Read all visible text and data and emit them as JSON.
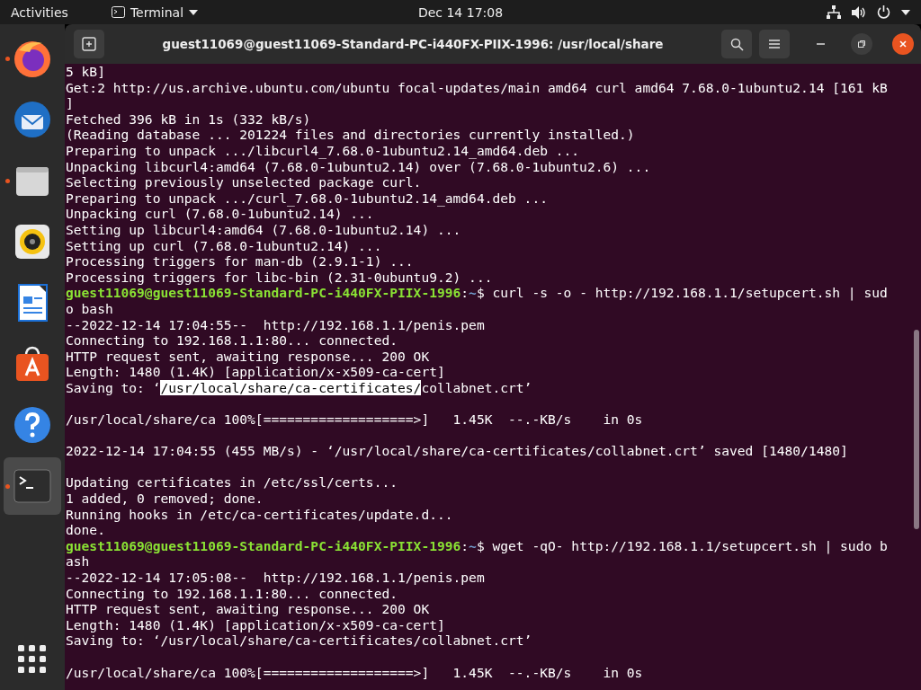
{
  "top_bar": {
    "activities": "Activities",
    "app_menu": "Terminal",
    "clock": "Dec 14  17:08"
  },
  "dock": {
    "items": [
      {
        "kind": "firefox",
        "running": true,
        "selected": false
      },
      {
        "kind": "thunderbird",
        "running": false,
        "selected": false
      },
      {
        "kind": "files",
        "running": true,
        "selected": false
      },
      {
        "kind": "rhythmbox",
        "running": false,
        "selected": false
      },
      {
        "kind": "writer",
        "running": false,
        "selected": false
      },
      {
        "kind": "software",
        "running": false,
        "selected": false
      },
      {
        "kind": "help",
        "running": false,
        "selected": false
      },
      {
        "kind": "terminal",
        "running": true,
        "selected": true
      }
    ]
  },
  "window": {
    "title": "guest11069@guest11069-Standard-PC-i440FX-PIIX-1996: /usr/local/share"
  },
  "terminal": {
    "lines": [
      {
        "segments": [
          {
            "kind": "plain",
            "text": "5 kB]"
          }
        ]
      },
      {
        "segments": [
          {
            "kind": "plain",
            "text": "Get:2 http://us.archive.ubuntu.com/ubuntu focal-updates/main amd64 curl amd64 7.68.0-1ubuntu2.14 [161 kB"
          }
        ]
      },
      {
        "segments": [
          {
            "kind": "plain",
            "text": "]"
          }
        ]
      },
      {
        "segments": [
          {
            "kind": "plain",
            "text": "Fetched 396 kB in 1s (332 kB/s)"
          }
        ]
      },
      {
        "segments": [
          {
            "kind": "plain",
            "text": "(Reading database ... 201224 files and directories currently installed.)"
          }
        ]
      },
      {
        "segments": [
          {
            "kind": "plain",
            "text": "Preparing to unpack .../libcurl4_7.68.0-1ubuntu2.14_amd64.deb ..."
          }
        ]
      },
      {
        "segments": [
          {
            "kind": "plain",
            "text": "Unpacking libcurl4:amd64 (7.68.0-1ubuntu2.14) over (7.68.0-1ubuntu2.6) ..."
          }
        ]
      },
      {
        "segments": [
          {
            "kind": "plain",
            "text": "Selecting previously unselected package curl."
          }
        ]
      },
      {
        "segments": [
          {
            "kind": "plain",
            "text": "Preparing to unpack .../curl_7.68.0-1ubuntu2.14_amd64.deb ..."
          }
        ]
      },
      {
        "segments": [
          {
            "kind": "plain",
            "text": "Unpacking curl (7.68.0-1ubuntu2.14) ..."
          }
        ]
      },
      {
        "segments": [
          {
            "kind": "plain",
            "text": "Setting up libcurl4:amd64 (7.68.0-1ubuntu2.14) ..."
          }
        ]
      },
      {
        "segments": [
          {
            "kind": "plain",
            "text": "Setting up curl (7.68.0-1ubuntu2.14) ..."
          }
        ]
      },
      {
        "segments": [
          {
            "kind": "plain",
            "text": "Processing triggers for man-db (2.9.1-1) ..."
          }
        ]
      },
      {
        "segments": [
          {
            "kind": "plain",
            "text": "Processing triggers for libc-bin (2.31-0ubuntu9.2) ..."
          }
        ]
      },
      {
        "segments": [
          {
            "kind": "user",
            "text": "guest11069@guest11069-Standard-PC-i440FX-PIIX-1996"
          },
          {
            "kind": "plain",
            "text": ":"
          },
          {
            "kind": "path",
            "text": "~"
          },
          {
            "kind": "plain",
            "text": "$ curl -s -o - http://192.168.1.1/setupcert.sh | sud"
          }
        ]
      },
      {
        "segments": [
          {
            "kind": "plain",
            "text": "o bash"
          }
        ]
      },
      {
        "segments": [
          {
            "kind": "plain",
            "text": "--2022-12-14 17:04:55--  http://192.168.1.1/penis.pem"
          }
        ]
      },
      {
        "segments": [
          {
            "kind": "plain",
            "text": "Connecting to 192.168.1.1:80... connected."
          }
        ]
      },
      {
        "segments": [
          {
            "kind": "plain",
            "text": "HTTP request sent, awaiting response... 200 OK"
          }
        ]
      },
      {
        "segments": [
          {
            "kind": "plain",
            "text": "Length: 1480 (1.4K) [application/x-x509-ca-cert]"
          }
        ]
      },
      {
        "segments": [
          {
            "kind": "plain",
            "text": "Saving to: ‘"
          },
          {
            "kind": "selected",
            "text": "/usr/local/share/ca-certificates/"
          },
          {
            "kind": "plain",
            "text": "collabnet.crt’"
          }
        ]
      },
      {
        "kind": "blank"
      },
      {
        "segments": [
          {
            "kind": "plain",
            "text": "/usr/local/share/ca 100%[===================>]   1.45K  --.-KB/s    in 0s"
          }
        ]
      },
      {
        "kind": "blank"
      },
      {
        "segments": [
          {
            "kind": "plain",
            "text": "2022-12-14 17:04:55 (455 MB/s) - ‘/usr/local/share/ca-certificates/collabnet.crt’ saved [1480/1480]"
          }
        ]
      },
      {
        "kind": "blank"
      },
      {
        "segments": [
          {
            "kind": "plain",
            "text": "Updating certificates in /etc/ssl/certs..."
          }
        ]
      },
      {
        "segments": [
          {
            "kind": "plain",
            "text": "1 added, 0 removed; done."
          }
        ]
      },
      {
        "segments": [
          {
            "kind": "plain",
            "text": "Running hooks in /etc/ca-certificates/update.d..."
          }
        ]
      },
      {
        "segments": [
          {
            "kind": "plain",
            "text": "done."
          }
        ]
      },
      {
        "segments": [
          {
            "kind": "user",
            "text": "guest11069@guest11069-Standard-PC-i440FX-PIIX-1996"
          },
          {
            "kind": "plain",
            "text": ":"
          },
          {
            "kind": "path",
            "text": "~"
          },
          {
            "kind": "plain",
            "text": "$ wget -qO- http://192.168.1.1/setupcert.sh | sudo b"
          }
        ]
      },
      {
        "segments": [
          {
            "kind": "plain",
            "text": "ash"
          }
        ]
      },
      {
        "segments": [
          {
            "kind": "plain",
            "text": "--2022-12-14 17:05:08--  http://192.168.1.1/penis.pem"
          }
        ]
      },
      {
        "segments": [
          {
            "kind": "plain",
            "text": "Connecting to 192.168.1.1:80... connected."
          }
        ]
      },
      {
        "segments": [
          {
            "kind": "plain",
            "text": "HTTP request sent, awaiting response... 200 OK"
          }
        ]
      },
      {
        "segments": [
          {
            "kind": "plain",
            "text": "Length: 1480 (1.4K) [application/x-x509-ca-cert]"
          }
        ]
      },
      {
        "segments": [
          {
            "kind": "plain",
            "text": "Saving to: ‘/usr/local/share/ca-certificates/collabnet.crt’"
          }
        ]
      },
      {
        "kind": "blank"
      },
      {
        "segments": [
          {
            "kind": "plain",
            "text": "/usr/local/share/ca 100%[===================>]   1.45K  --.-KB/s    in 0s"
          }
        ]
      }
    ]
  }
}
